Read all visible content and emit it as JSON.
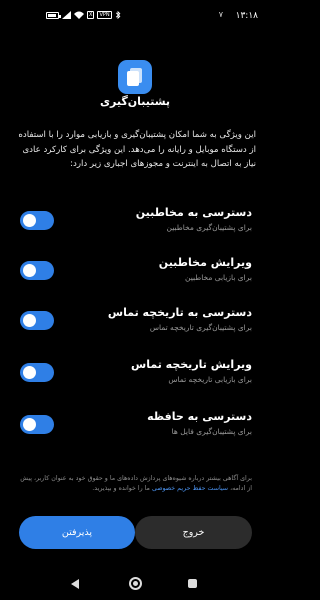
{
  "status_bar": {
    "time": "۱۳:۱۸",
    "alarm_count": "۷",
    "icons": [
      "battery-icon",
      "signal-icon",
      "wifi-icon",
      "box-icon",
      "vpn-icon",
      "bluetooth-icon"
    ],
    "box_label": "X",
    "vpn_label": "VPN"
  },
  "header": {
    "icon": "backup-app-icon",
    "title": "پشتیبان‌گیری"
  },
  "description": "این ویژگی به شما امکان پشتیبان‌گیری و بازیابی موارد را با استفاده از دستگاه موبایل و رایانه را می‌دهد. این ویژگی برای کارکرد عادی نیاز به اتصال به اینترنت و مجوزهای اجباری زیر دارد:",
  "permissions": [
    {
      "title": "دسترسی به مخاطبین",
      "subtitle": "برای پشتیبان‌گیری مخاطبین",
      "enabled": true
    },
    {
      "title": "ویرایش مخاطبین",
      "subtitle": "برای بازیابی مخاطبین",
      "enabled": true
    },
    {
      "title": "دسترسی به تاریخچه تماس",
      "subtitle": "برای پشتیبان‌گیری تاریخچه تماس",
      "enabled": true
    },
    {
      "title": "ویرایش تاریخچه تماس",
      "subtitle": "برای بازیابی تاریخچه تماس",
      "enabled": true
    },
    {
      "title": "دسترسی به حافظه",
      "subtitle": "برای پشتیبان‌گیری فایل ها",
      "enabled": true
    }
  ],
  "footer": {
    "note_part1": "برای آگاهی بیشتر درباره شیوه‌های پردازش داده‌های ما و حقوق خود به عنوان کاربر، پیش از ادامه،",
    "link_text": "سیاست حفظ حریم خصوصی",
    "note_part2": "ما را خوانده و بپذیرید."
  },
  "buttons": {
    "accept": "پذیرفتن",
    "exit": "خروج"
  },
  "colors": {
    "accent": "#2f7fe6",
    "background": "#000000",
    "secondary_button": "#2c2c2c",
    "link": "#4b92ee"
  }
}
